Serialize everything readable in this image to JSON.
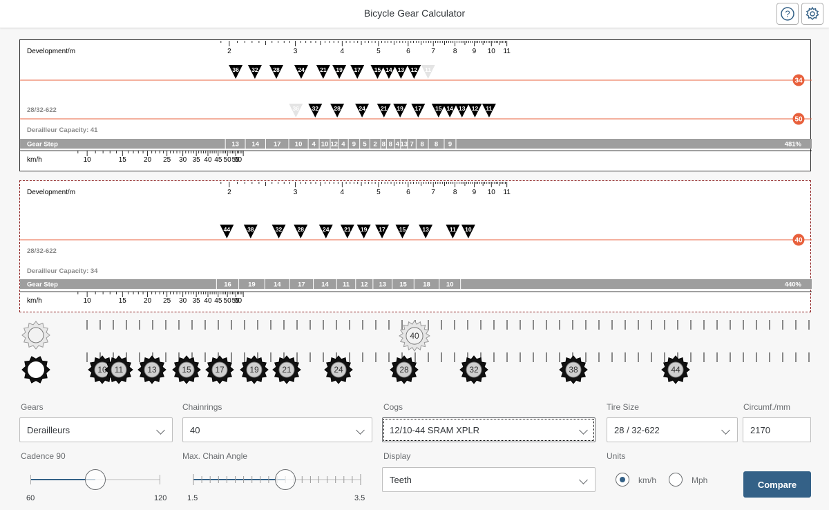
{
  "app": {
    "title": "Bicycle Gear Calculator"
  },
  "header": {
    "help_icon": "help-icon",
    "settings_icon": "gear-settings-icon"
  },
  "chart1": {
    "dev_label": "Development/m",
    "dev_ticks": [
      2,
      3,
      4,
      5,
      6,
      7,
      8,
      9,
      10,
      11
    ],
    "tire_label": "28/32-622",
    "capacity_label": "Derailleur Capacity: 41",
    "gear_step_label": "Gear Step",
    "speed_label": "km/h",
    "speed_ticks": [
      10,
      15,
      20,
      25,
      30,
      35,
      40,
      45,
      50,
      55,
      60
    ],
    "rings": [
      {
        "teeth": "34",
        "cogs": [
          {
            "t": "36",
            "dev": 2.08
          },
          {
            "t": "32",
            "dev": 2.34
          },
          {
            "t": "28",
            "dev": 2.67
          },
          {
            "t": "24",
            "dev": 3.11
          },
          {
            "t": "21",
            "dev": 3.56
          },
          {
            "t": "19",
            "dev": 3.93
          },
          {
            "t": "17",
            "dev": 4.39
          },
          {
            "t": "15",
            "dev": 4.97
          },
          {
            "t": "14",
            "dev": 5.33
          },
          {
            "t": "13",
            "dev": 5.74
          },
          {
            "t": "12",
            "dev": 6.22
          },
          {
            "t": "11",
            "dev": 6.78,
            "faded": true
          }
        ]
      },
      {
        "teeth": "50",
        "cogs": [
          {
            "t": "36",
            "dev": 3.01,
            "faded": true
          },
          {
            "t": "32",
            "dev": 3.39
          },
          {
            "t": "28",
            "dev": 3.88
          },
          {
            "t": "24",
            "dev": 4.52
          },
          {
            "t": "21",
            "dev": 5.17
          },
          {
            "t": "19",
            "dev": 5.71
          },
          {
            "t": "17",
            "dev": 6.38
          },
          {
            "t": "15",
            "dev": 7.23
          },
          {
            "t": "14",
            "dev": 7.75
          },
          {
            "t": "13",
            "dev": 8.35
          },
          {
            "t": "12",
            "dev": 9.04
          },
          {
            "t": "11",
            "dev": 9.86
          }
        ]
      }
    ],
    "gear_steps": [
      "13",
      "14",
      "17",
      "10",
      "4",
      "10",
      "12",
      "4",
      "9",
      "5",
      "2",
      "8",
      "8",
      "4",
      "13",
      "7",
      "8",
      "8",
      "9",
      "481%"
    ]
  },
  "chart2": {
    "dev_label": "Development/m",
    "dev_ticks": [
      2,
      3,
      4,
      5,
      6,
      7,
      8,
      9,
      10,
      11
    ],
    "tire_label": "28/32-622",
    "capacity_label": "Derailleur Capacity: 34",
    "gear_step_label": "Gear Step",
    "speed_label": "km/h",
    "speed_ticks": [
      10,
      15,
      20,
      25,
      30,
      35,
      40,
      45,
      50,
      55,
      60
    ],
    "rings": [
      {
        "teeth": "40",
        "cogs": [
          {
            "t": "44",
            "dev": 1.97
          },
          {
            "t": "38",
            "dev": 2.28
          },
          {
            "t": "32",
            "dev": 2.71
          },
          {
            "t": "28",
            "dev": 3.1
          },
          {
            "t": "24",
            "dev": 3.62
          },
          {
            "t": "21",
            "dev": 4.13
          },
          {
            "t": "19",
            "dev": 4.57
          },
          {
            "t": "17",
            "dev": 5.11
          },
          {
            "t": "15",
            "dev": 5.79
          },
          {
            "t": "13",
            "dev": 6.68
          },
          {
            "t": "11",
            "dev": 7.89
          },
          {
            "t": "10",
            "dev": 8.68
          }
        ]
      }
    ],
    "gear_steps": [
      "16",
      "19",
      "14",
      "17",
      "14",
      "11",
      "12",
      "13",
      "15",
      "18",
      "10",
      "440%"
    ]
  },
  "drivetrain": {
    "ring_label": "40",
    "cogs": [
      "10",
      "11",
      "13",
      "15",
      "17",
      "19",
      "21",
      "24",
      "28",
      "32",
      "38",
      "44"
    ]
  },
  "controls": {
    "gears_label": "Gears",
    "gears_value": "Derailleurs",
    "chainrings_label": "Chainrings",
    "chainrings_value": "40",
    "cogs_label": "Cogs",
    "cogs_value": "12/10-44 SRAM XPLR",
    "tire_label": "Tire Size",
    "tire_value": "28 / 32-622",
    "circ_label": "Circumf./mm",
    "circ_value": "2170",
    "cadence_label": "Cadence 90",
    "cadence_min": "60",
    "cadence_max": "120",
    "cadence_fraction": 0.5,
    "angle_label": "Max. Chain Angle",
    "angle_min": "1.5",
    "angle_max": "3.5",
    "angle_fraction": 0.55,
    "display_label": "Display",
    "display_value": "Teeth",
    "units_label": "Units",
    "unit_kmh": "km/h",
    "unit_mph": "Mph",
    "compare_label": "Compare"
  },
  "colors": {
    "accent": "#346187",
    "ring_line": "#e8603c",
    "ring_badge": "#e8603c",
    "gear_step_bar": "#9e9e9e"
  }
}
